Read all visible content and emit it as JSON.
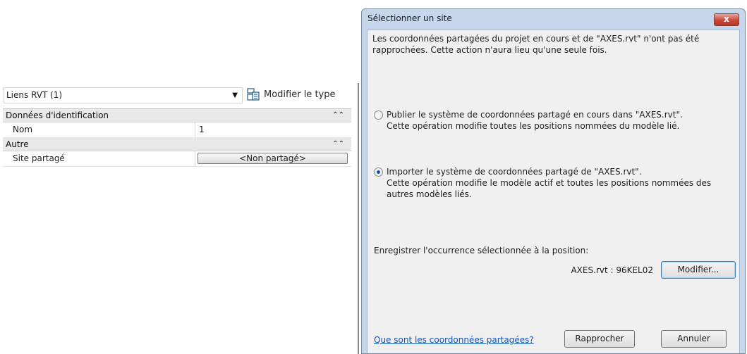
{
  "properties": {
    "type_selector": "Liens RVT (1)",
    "edit_type_label": "Modifier le type",
    "sections": [
      {
        "title": "Données d'identification",
        "rows": [
          {
            "key": "Nom",
            "value": "1"
          }
        ]
      },
      {
        "title": "Autre",
        "rows": [
          {
            "key": "Site partagé",
            "value": "<Non partagé>"
          }
        ]
      }
    ]
  },
  "dialog": {
    "title": "Sélectionner un site",
    "close_label": "x",
    "description": "Les coordonnées partagées du projet en cours et de \"AXES.rvt\" n'ont pas été rapprochées. Cette action n'aura lieu qu'une seule fois.",
    "option_publish": "Publier le système de coordonnées partagé en cours dans \"AXES.rvt\".\nCette opération modifie toutes les positions nommées du modèle lié.",
    "option_import": "Importer le système de coordonnées partagé de \"AXES.rvt\".\nCette opération modifie le modèle actif et toutes les positions nommées des autres modèles liés.",
    "selected_option": "import",
    "save_label": "Enregistrer l'occurrence sélectionnée à la position:",
    "position_value": "AXES.rvt : 96KEL02",
    "modify_button": "Modifier...",
    "help_link": "Que sont les coordonnées partagées?",
    "reconcile_button": "Rapprocher",
    "cancel_button": "Annuler"
  }
}
